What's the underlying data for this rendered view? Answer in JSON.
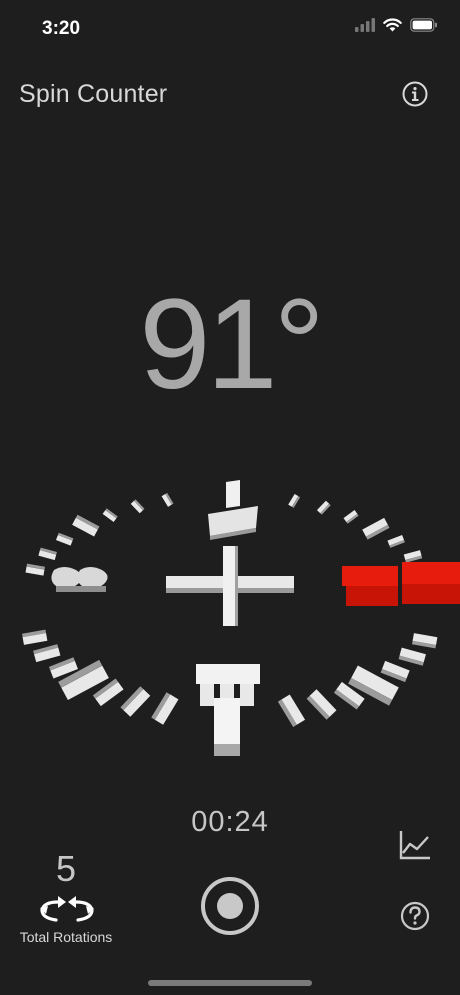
{
  "status_bar": {
    "time": "3:20",
    "icons": [
      "signal-icon",
      "wifi-icon",
      "battery-icon"
    ]
  },
  "header": {
    "title": "Spin Counter",
    "info_icon": "info-icon"
  },
  "angle": "91°",
  "dial": {
    "north_label": "N",
    "south_label": "S",
    "east_label": "E",
    "west_label": "W",
    "highlight_color": "#e81c0c",
    "tick_color": "#e8e8e8"
  },
  "timer": "00:24",
  "rotations": {
    "count": "5",
    "label": "Total Rotations",
    "icon": "rotate-arrows-icon"
  },
  "controls": {
    "record_icon": "record-icon",
    "chart_icon": "chart-icon",
    "help_icon": "help-icon"
  },
  "colors": {
    "background": "#1e1e1e",
    "text_primary": "#d8d8d8",
    "angle_text": "#a8a8a8"
  }
}
